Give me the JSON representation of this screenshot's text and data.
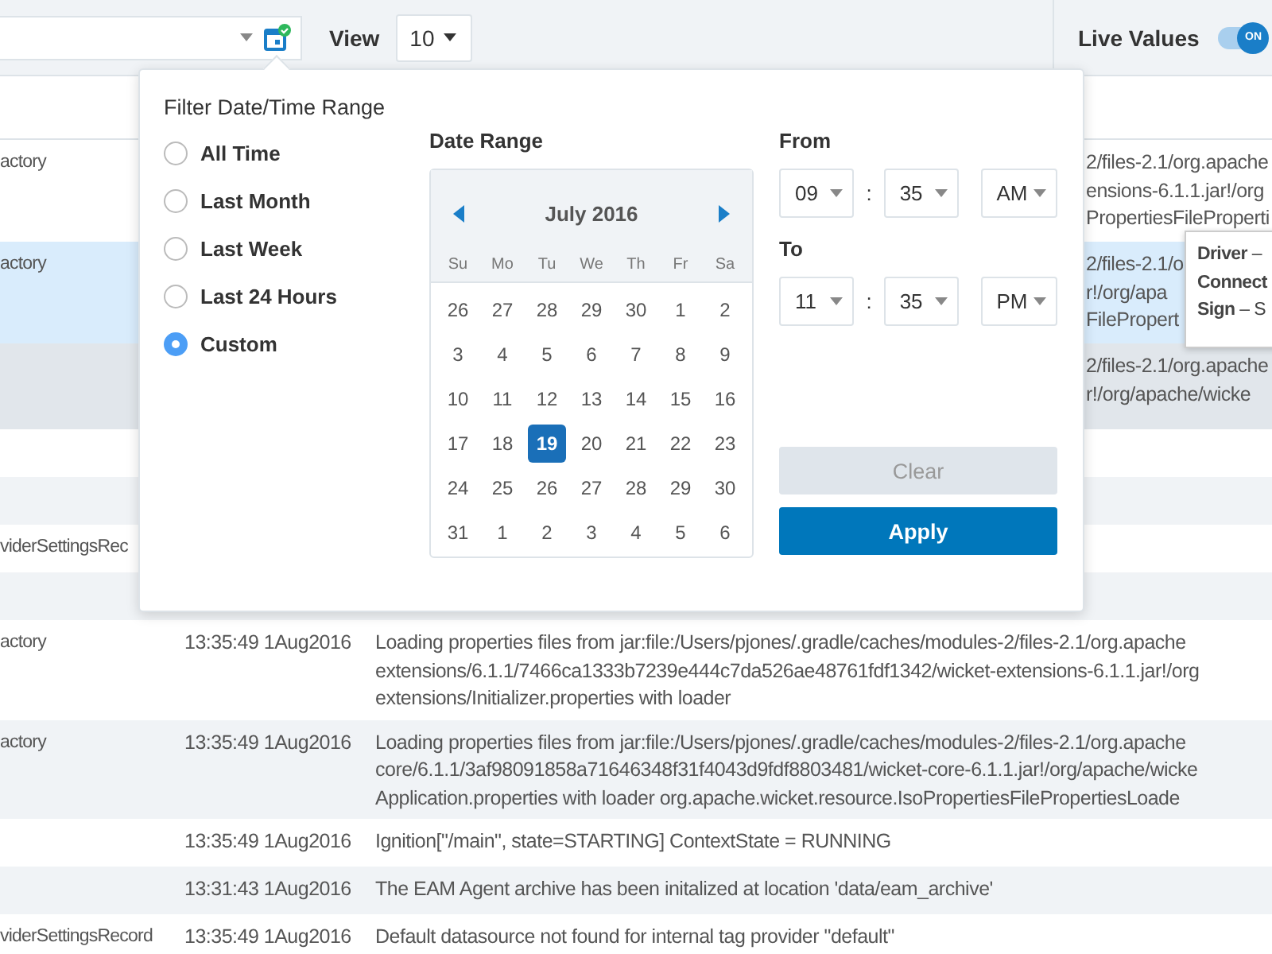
{
  "toolbar": {
    "view_label": "View",
    "view_select": "10",
    "live_values": {
      "label": "Live Values",
      "toggle": {
        "on": true,
        "text": "ON"
      }
    }
  },
  "popover": {
    "title": "Filter Date/Time Range",
    "presets": [
      {
        "label": "All Time",
        "selected": false
      },
      {
        "label": "Last Month",
        "selected": false
      },
      {
        "label": "Last Week",
        "selected": false
      },
      {
        "label": "Last 24 Hours",
        "selected": false
      },
      {
        "label": "Custom",
        "selected": true
      }
    ],
    "date_range": {
      "label": "Date Range",
      "month": "July 2016",
      "weekdays": [
        "Su",
        "Mo",
        "Tu",
        "We",
        "Th",
        "Fr",
        "Sa"
      ],
      "weeks": [
        [
          {
            "day": "26",
            "selected": false
          },
          {
            "day": "27",
            "selected": false
          },
          {
            "day": "28",
            "selected": false
          },
          {
            "day": "29",
            "selected": false
          },
          {
            "day": "30",
            "selected": false
          },
          {
            "day": "1",
            "selected": false
          },
          {
            "day": "2",
            "selected": false
          }
        ],
        [
          {
            "day": "3",
            "selected": false
          },
          {
            "day": "4",
            "selected": false
          },
          {
            "day": "5",
            "selected": false
          },
          {
            "day": "6",
            "selected": false
          },
          {
            "day": "7",
            "selected": false
          },
          {
            "day": "8",
            "selected": false
          },
          {
            "day": "9",
            "selected": false
          }
        ],
        [
          {
            "day": "10",
            "selected": false
          },
          {
            "day": "11",
            "selected": false
          },
          {
            "day": "12",
            "selected": false
          },
          {
            "day": "13",
            "selected": false
          },
          {
            "day": "14",
            "selected": false
          },
          {
            "day": "15",
            "selected": false
          },
          {
            "day": "16",
            "selected": false
          }
        ],
        [
          {
            "day": "17",
            "selected": false
          },
          {
            "day": "18",
            "selected": false
          },
          {
            "day": "19",
            "selected": true
          },
          {
            "day": "20",
            "selected": false
          },
          {
            "day": "21",
            "selected": false
          },
          {
            "day": "22",
            "selected": false
          },
          {
            "day": "23",
            "selected": false
          }
        ],
        [
          {
            "day": "24",
            "selected": false
          },
          {
            "day": "25",
            "selected": false
          },
          {
            "day": "26",
            "selected": false
          },
          {
            "day": "27",
            "selected": false
          },
          {
            "day": "28",
            "selected": false
          },
          {
            "day": "29",
            "selected": false
          },
          {
            "day": "30",
            "selected": false
          }
        ],
        [
          {
            "day": "31",
            "selected": false
          },
          {
            "day": "1",
            "selected": false
          },
          {
            "day": "2",
            "selected": false
          },
          {
            "day": "3",
            "selected": false
          },
          {
            "day": "4",
            "selected": false
          },
          {
            "day": "5",
            "selected": false
          },
          {
            "day": "6",
            "selected": false
          }
        ]
      ]
    },
    "from": {
      "label": "From",
      "hour": "09",
      "separator": ":",
      "minute": "35",
      "ampm": "AM"
    },
    "to": {
      "label": "To",
      "hour": "11",
      "separator": ":",
      "minute": "35",
      "ampm": "PM"
    },
    "clear": {
      "label": "Clear",
      "disabled": true
    },
    "apply": {
      "label": "Apply",
      "disabled": false
    }
  },
  "tooltip": {
    "lines": [
      "**Driver** –",
      "Connect",
      "**Sign** – S"
    ]
  },
  "rows": [
    {
      "kind": "covered",
      "selected": false,
      "hovered": false,
      "source": "actory",
      "fragment_lines": [
        "2/files-2.1/org.apache",
        "ensions-6.1.1.jar!/org",
        "PropertiesFileProperti"
      ]
    },
    {
      "kind": "covered",
      "selected": true,
      "hovered": false,
      "source": "actory",
      "fragment_lines": [
        "2/files-2.1/o",
        "r!/org/apa",
        "FilePropert"
      ]
    },
    {
      "kind": "covered",
      "selected": false,
      "hovered": true,
      "fragment_lines": [
        "2/files-2.1/org.apache",
        "r!/org/apache/wicke"
      ]
    },
    {
      "kind": "covered",
      "selected": false,
      "hovered": false
    },
    {
      "kind": "covered",
      "selected": false,
      "hovered": false
    },
    {
      "kind": "covered",
      "selected": false,
      "hovered": false,
      "source": "viderSettingsRec"
    },
    {
      "kind": "covered",
      "selected": false,
      "hovered": false
    },
    {
      "kind": "full",
      "selected": false,
      "hovered": false,
      "source": "actory",
      "time": "13:35:49 1Aug2016",
      "message_lines": [
        "Loading properties files from jar:file:/Users/pjones/.gradle/caches/modules-2/files-2.1/org.apache",
        "extensions/6.1.1/7466ca1333b7239e444c7da526ae48761fdf1342/wicket-extensions-6.1.1.jar!/org",
        "extensions/Initializer.properties with loader"
      ]
    },
    {
      "kind": "full",
      "selected": false,
      "hovered": false,
      "source": "actory",
      "time": "13:35:49 1Aug2016",
      "message_lines": [
        "Loading properties files from jar:file:/Users/pjones/.gradle/caches/modules-2/files-2.1/org.apache",
        "core/6.1.1/3af98091858a71646348f31f4043d9fdf8803481/wicket-core-6.1.1.jar!/org/apache/wicke",
        "Application.properties with loader org.apache.wicket.resource.IsoPropertiesFilePropertiesLoade"
      ]
    },
    {
      "kind": "full",
      "selected": false,
      "hovered": false,
      "time": "13:35:49 1Aug2016",
      "message_lines": [
        "Ignition[\"/main\", state=STARTING] ContextState = RUNNING"
      ]
    },
    {
      "kind": "full",
      "selected": false,
      "hovered": false,
      "time": "13:31:43 1Aug2016",
      "message_lines": [
        "The EAM Agent archive has been initalized at location 'data/eam_archive'"
      ]
    },
    {
      "kind": "full",
      "selected": false,
      "hovered": false,
      "source": "viderSettingsRecord",
      "time": "13:35:49 1Aug2016",
      "message_lines": [
        "Default datasource not found for internal tag provider \"default\""
      ]
    }
  ]
}
